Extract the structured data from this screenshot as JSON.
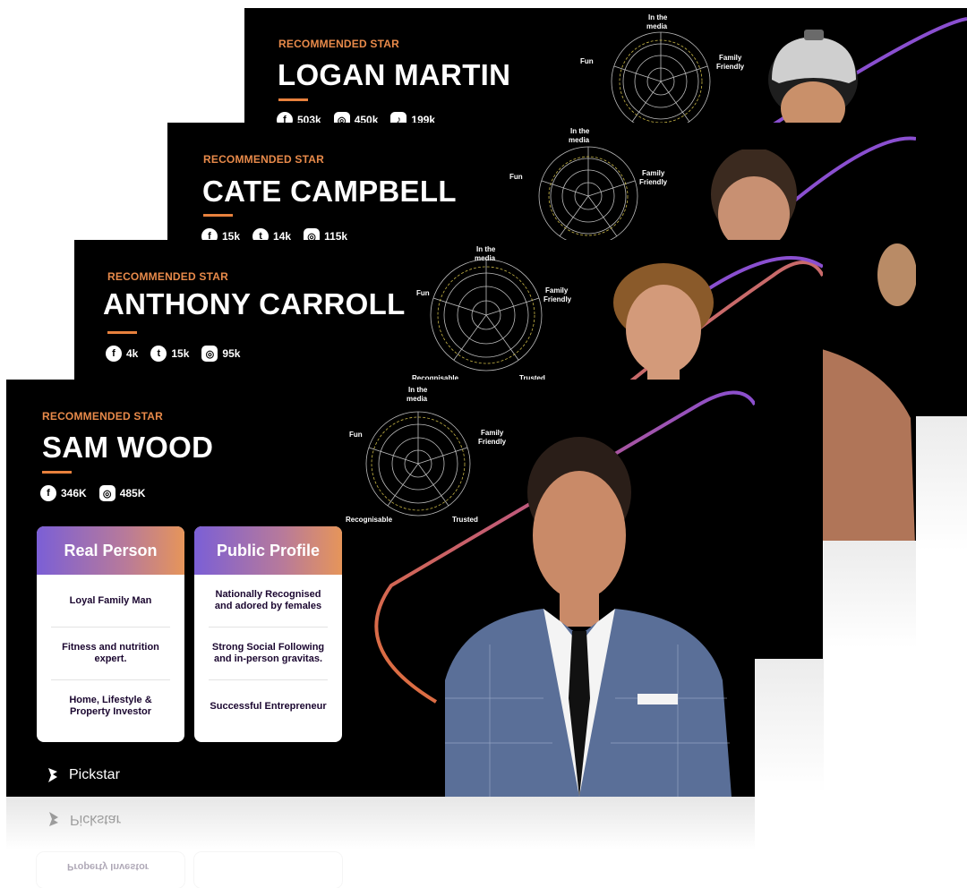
{
  "cards": [
    {
      "id": "logan",
      "label": "RECOMMENDED STAR",
      "first": "LOGAN",
      "last": "MARTIN",
      "socials": [
        {
          "icon": "facebook-icon",
          "glyph": "f",
          "value": "503k"
        },
        {
          "icon": "instagram-icon",
          "glyph": "◎",
          "value": "450k"
        },
        {
          "icon": "tiktok-icon",
          "glyph": "♪",
          "value": "199k"
        }
      ],
      "radar": {
        "top": "In the",
        "top2": "media",
        "left": "Fun",
        "right": "Family",
        "right2": "Friendly"
      }
    },
    {
      "id": "cate",
      "label": "RECOMMENDED STAR",
      "first": "CATE",
      "last": "CAMPBELL",
      "socials": [
        {
          "icon": "facebook-icon",
          "glyph": "f",
          "value": "15k"
        },
        {
          "icon": "twitter-icon",
          "glyph": "t",
          "value": "14k"
        },
        {
          "icon": "instagram-icon",
          "glyph": "◎",
          "value": "115k"
        }
      ],
      "radar": {
        "top": "In the",
        "top2": "media",
        "left": "Fun",
        "right": "Family",
        "right2": "Friendly"
      }
    },
    {
      "id": "anthony",
      "label": "RECOMMENDED STAR",
      "first": "ANTHONY",
      "last": "CARROLL",
      "socials": [
        {
          "icon": "facebook-icon",
          "glyph": "f",
          "value": "4k"
        },
        {
          "icon": "twitter-icon",
          "glyph": "t",
          "value": "15k"
        },
        {
          "icon": "instagram-icon",
          "glyph": "◎",
          "value": "95k"
        }
      ],
      "radar": {
        "top": "In the",
        "top2": "media",
        "left": "Fun",
        "right": "Family",
        "right2": "Friendly",
        "bl": "Recognisable",
        "br": "Trusted"
      }
    },
    {
      "id": "sam",
      "label": "RECOMMENDED STAR",
      "first": "SAM",
      "last": "WOOD",
      "socials": [
        {
          "icon": "facebook-icon",
          "glyph": "f",
          "value": "346K"
        },
        {
          "icon": "instagram-icon",
          "glyph": "◎",
          "value": "485K"
        }
      ],
      "radar": {
        "top": "In the",
        "top2": "media",
        "left": "Fun",
        "right": "Family",
        "right2": "Friendly",
        "bl": "Recognisable",
        "br": "Trusted"
      },
      "panels": [
        {
          "title": "Real Person",
          "rows": [
            "Loyal Family Man",
            "Fitness and nutrition expert.",
            "Home, Lifestyle & Property Investor"
          ]
        },
        {
          "title": "Public Profile",
          "rows": [
            "Nationally Recognised and adored by females",
            "Strong Social Following and in-person gravitas.",
            "Successful Entrepreneur"
          ]
        }
      ],
      "logo": "Pickstar"
    }
  ],
  "reflection": {
    "logo": "Pickstar",
    "text": "Property Investor"
  },
  "colors": {
    "accent": "#e8813d",
    "purple": "#8a4fd0",
    "panel_text": "#1b0730"
  }
}
